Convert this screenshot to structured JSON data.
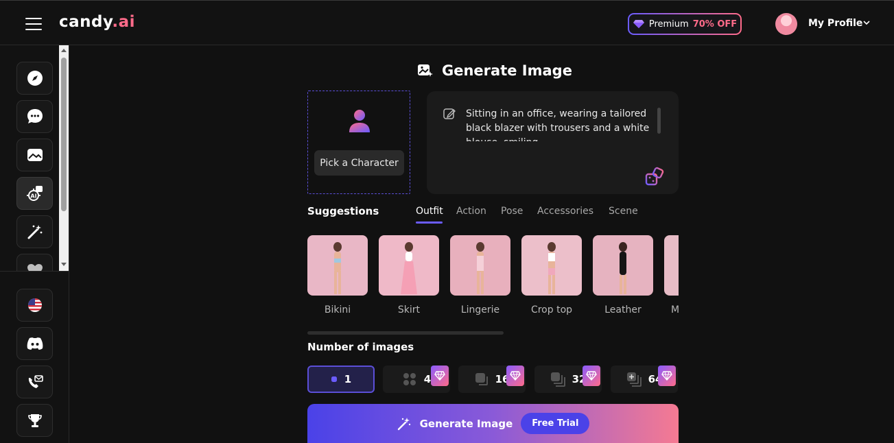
{
  "header": {
    "logo_main": "candy",
    "logo_ai": ".ai",
    "premium_label": "Premium",
    "premium_discount": "70% OFF",
    "profile_label": "My Profile"
  },
  "sidebar": {
    "top_items": [
      {
        "name": "explore",
        "icon": "compass-icon"
      },
      {
        "name": "chat",
        "icon": "chat-bubble-icon"
      },
      {
        "name": "gallery",
        "icon": "image-icon"
      },
      {
        "name": "generate-image",
        "icon": "ai-image-icon",
        "active": true
      },
      {
        "name": "create-character",
        "icon": "magic-wand-icon"
      },
      {
        "name": "my-ai",
        "icon": "heart-icon"
      }
    ],
    "bottom_items": [
      {
        "name": "language",
        "icon": "us-flag-icon"
      },
      {
        "name": "discord",
        "icon": "discord-icon"
      },
      {
        "name": "contact",
        "icon": "mail-icon"
      },
      {
        "name": "leaderboard",
        "icon": "trophy-icon"
      }
    ]
  },
  "main": {
    "title": "Generate Image",
    "pick_character_label": "Pick a Character",
    "prompt_text": "Sitting in an office, wearing a tailored black blazer with trousers and a white blouse, smiling",
    "suggestions_label": "Suggestions",
    "tabs": [
      "Outfit",
      "Action",
      "Pose",
      "Accessories",
      "Scene"
    ],
    "active_tab": "Outfit",
    "suggestions": [
      {
        "label": "Bikini",
        "color": "#e9b7c6"
      },
      {
        "label": "Skirt",
        "color": "#efb9c8"
      },
      {
        "label": "Lingerie",
        "color": "#e8b0bd"
      },
      {
        "label": "Crop top",
        "color": "#ecbfca"
      },
      {
        "label": "Leather",
        "color": "#e6b3c0"
      },
      {
        "label": "M",
        "color": "#e7bcc6"
      }
    ],
    "num_images_label": "Number of images",
    "num_options": [
      {
        "value": "1",
        "selected": true,
        "premium": false
      },
      {
        "value": "4",
        "selected": false,
        "premium": true
      },
      {
        "value": "16",
        "selected": false,
        "premium": true
      },
      {
        "value": "32",
        "selected": false,
        "premium": true
      },
      {
        "value": "64",
        "selected": false,
        "premium": true
      }
    ],
    "generate_label": "Generate Image",
    "free_trial_label": "Free Trial"
  },
  "colors": {
    "accent": "#6b5cff",
    "pink": "#ff6b8a",
    "background": "#111111"
  }
}
